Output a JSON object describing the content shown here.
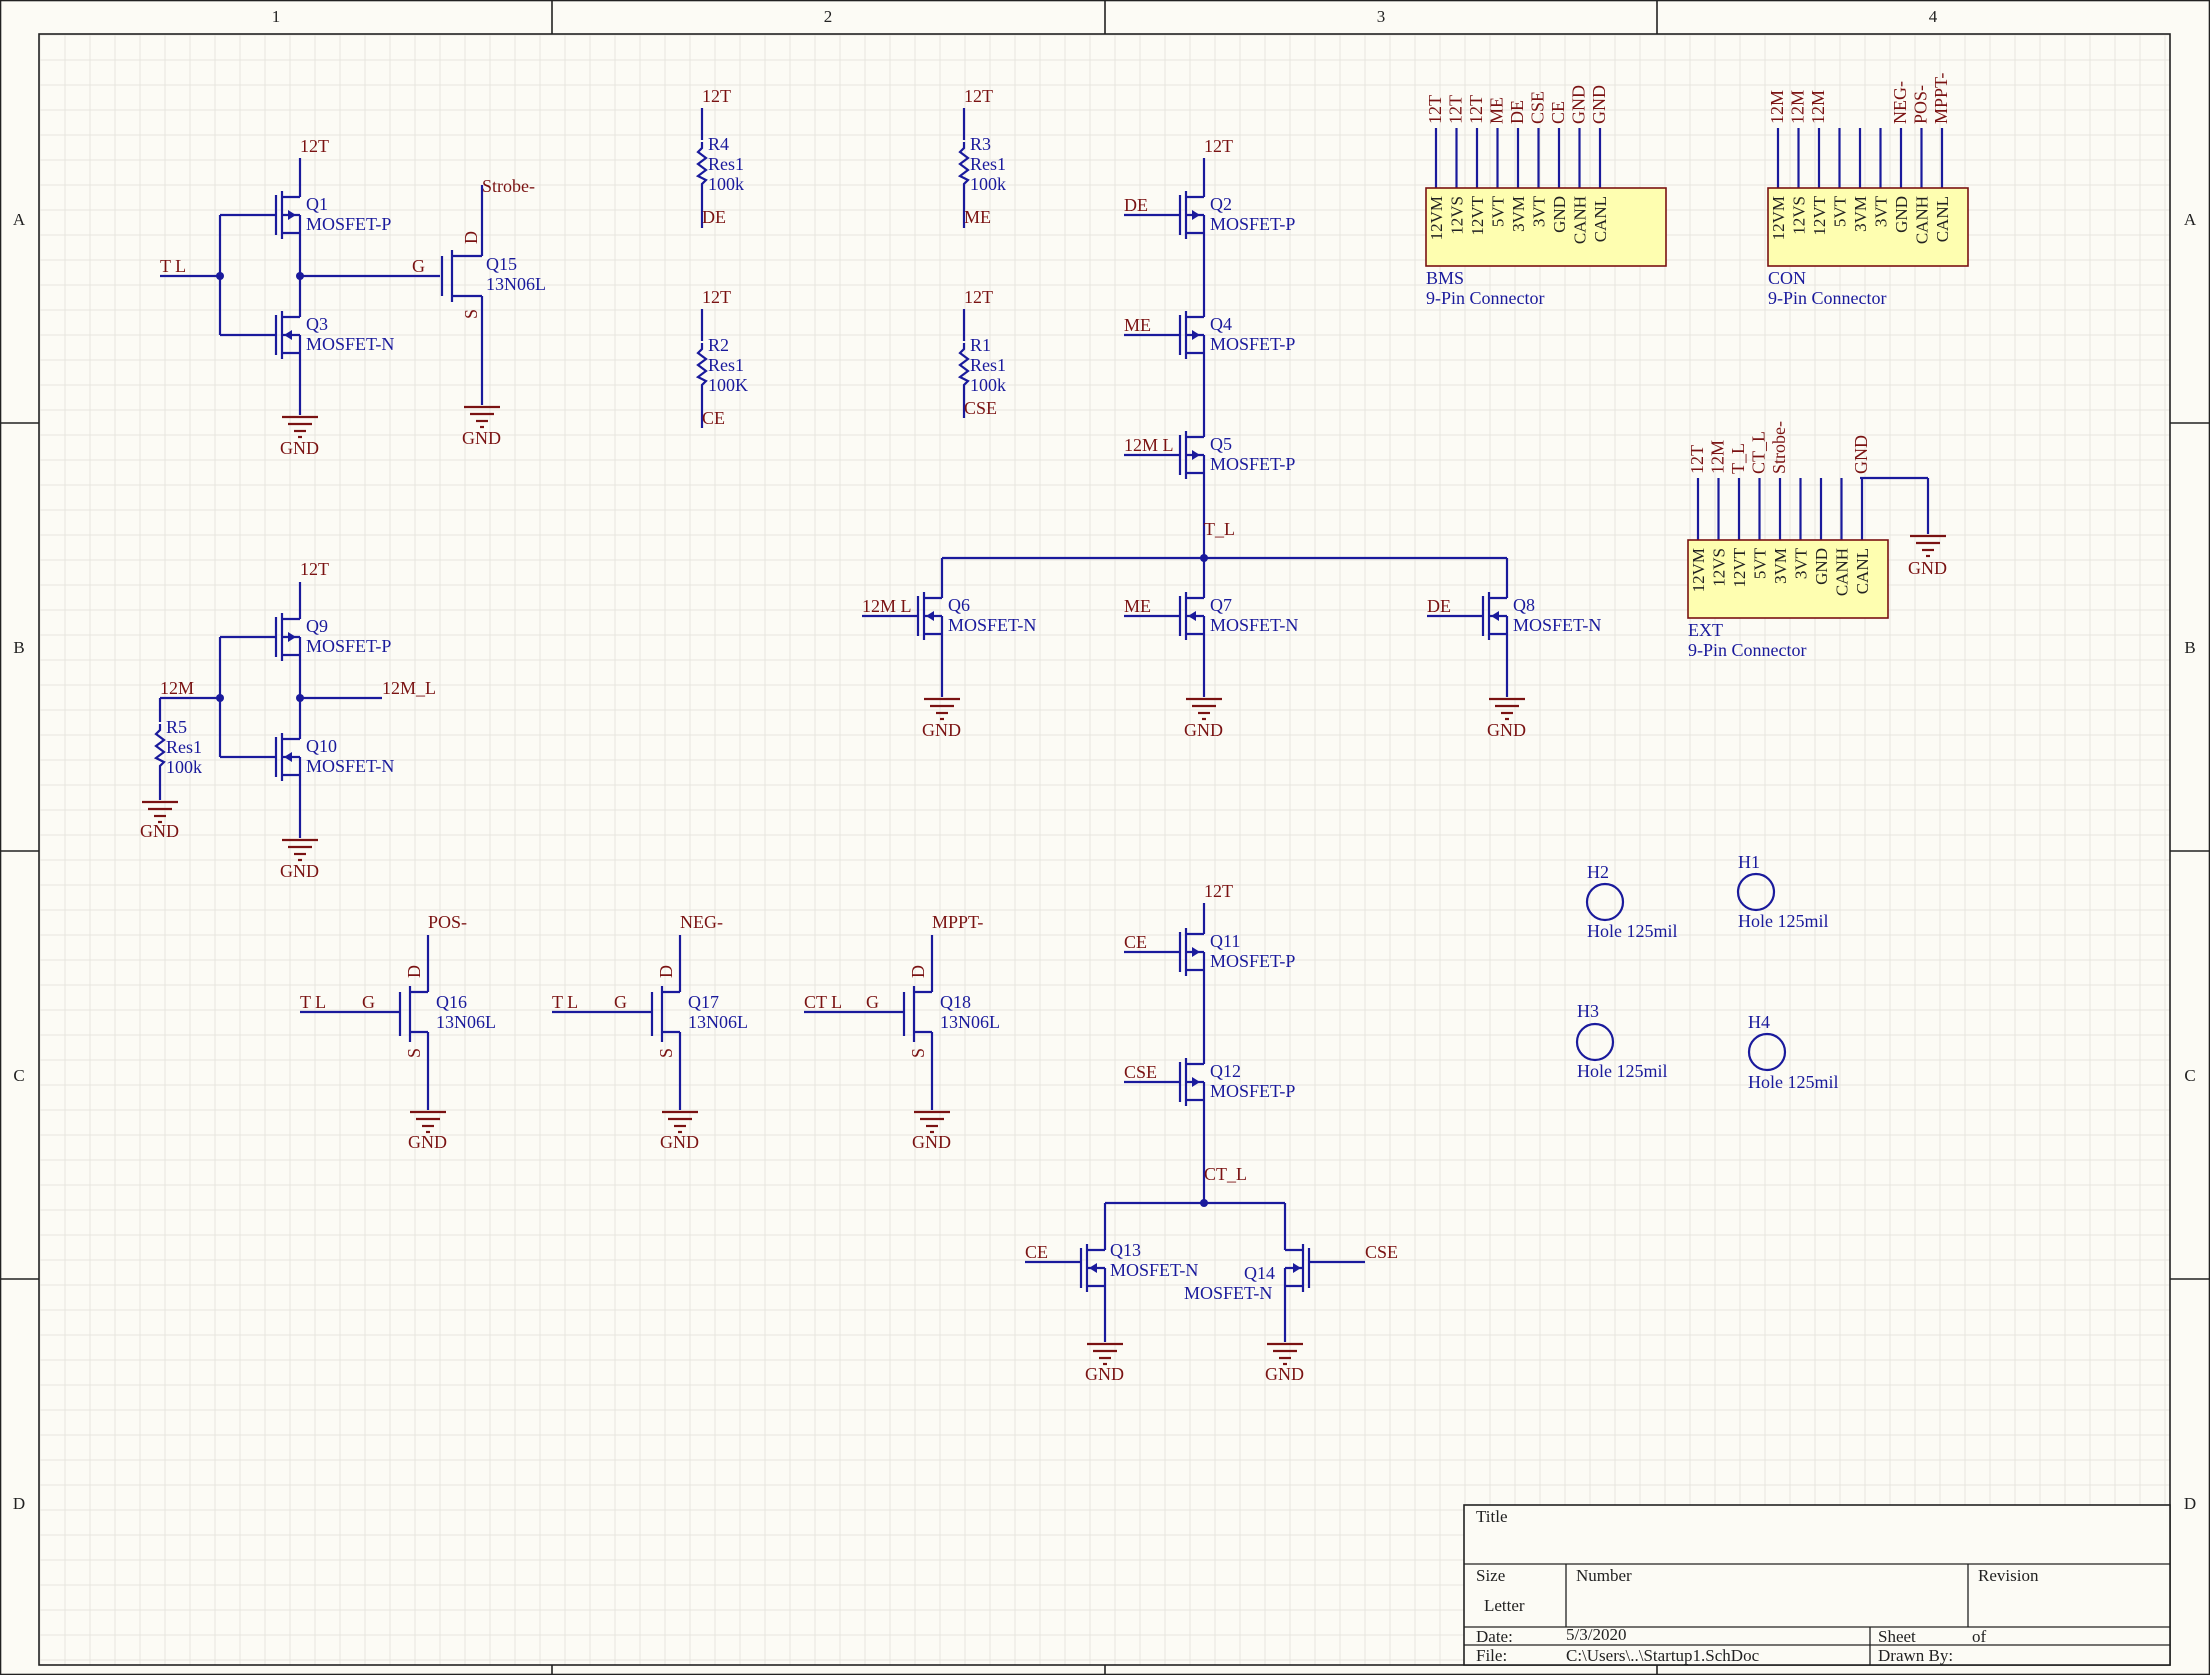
{
  "sheet": {
    "columns": [
      "1",
      "2",
      "3",
      "4"
    ],
    "rows": [
      "A",
      "B",
      "C",
      "D"
    ]
  },
  "components": {
    "Q1": {
      "designator": "Q1",
      "type": "MOSFET-P"
    },
    "Q3": {
      "designator": "Q3",
      "type": "MOSFET-N"
    },
    "Q9": {
      "designator": "Q9",
      "type": "MOSFET-P"
    },
    "Q10": {
      "designator": "Q10",
      "type": "MOSFET-N"
    },
    "Q15": {
      "designator": "Q15",
      "type": "13N06L"
    },
    "Q2": {
      "designator": "Q2",
      "type": "MOSFET-P"
    },
    "Q4": {
      "designator": "Q4",
      "type": "MOSFET-P"
    },
    "Q5": {
      "designator": "Q5",
      "type": "MOSFET-P"
    },
    "Q6": {
      "designator": "Q6",
      "type": "MOSFET-N"
    },
    "Q7": {
      "designator": "Q7",
      "type": "MOSFET-N"
    },
    "Q8": {
      "designator": "Q8",
      "type": "MOSFET-N"
    },
    "Q11": {
      "designator": "Q11",
      "type": "MOSFET-P"
    },
    "Q12": {
      "designator": "Q12",
      "type": "MOSFET-P"
    },
    "Q13": {
      "designator": "Q13",
      "type": "MOSFET-N"
    },
    "Q14": {
      "designator": "Q14",
      "type": "MOSFET-N"
    },
    "Q16": {
      "designator": "Q16",
      "type": "13N06L"
    },
    "Q17": {
      "designator": "Q17",
      "type": "13N06L"
    },
    "Q18": {
      "designator": "Q18",
      "type": "13N06L"
    },
    "R1": {
      "designator": "R1",
      "type": "Res1",
      "value": "100k"
    },
    "R2": {
      "designator": "R2",
      "type": "Res1",
      "value": "100K"
    },
    "R3": {
      "designator": "R3",
      "type": "Res1",
      "value": "100k"
    },
    "R4": {
      "designator": "R4",
      "type": "Res1",
      "value": "100k"
    },
    "R5": {
      "designator": "R5",
      "type": "Res1",
      "value": "100k"
    }
  },
  "nets": {
    "n12T": "12T",
    "gnd": "GND",
    "strobe": "Strobe-",
    "tl": "T_L",
    "tl_sp": "T  L",
    "m12": "12M",
    "m12l": "12M_L",
    "m12l_sp": "12M  L",
    "de": "DE",
    "me": "ME",
    "ce": "CE",
    "cse": "CSE",
    "ctl": "CT_L",
    "ctl_sp": "CT  L",
    "pos": "POS-",
    "neg": "NEG-",
    "mppt": "MPPT-",
    "g": "G",
    "d": "D",
    "s": "S"
  },
  "connectors": {
    "bms": {
      "name": "BMS",
      "type": "9-Pin Connector",
      "nets": [
        "12T",
        "12T",
        "12T",
        "ME",
        "DE",
        "CSE",
        "CE",
        "GND",
        "GND"
      ],
      "pins": [
        "12VM",
        "12VS",
        "12VT",
        "5VT",
        "3VM",
        "3VT",
        "GND",
        "CANH",
        "CANL"
      ]
    },
    "con": {
      "name": "CON",
      "type": "9-Pin Connector",
      "nets": [
        "12M",
        "12M",
        "12M",
        "",
        "",
        "",
        "NEG-",
        "POS-",
        "MPPT-"
      ],
      "pins": [
        "12VM",
        "12VS",
        "12VT",
        "5VT",
        "3VM",
        "3VT",
        "GND",
        "CANH",
        "CANL"
      ]
    },
    "ext": {
      "name": "EXT",
      "type": "9-Pin Connector",
      "nets": [
        "12T",
        "12M",
        "T_L",
        "CT_L",
        "Strobe-",
        "",
        "",
        "",
        "GND"
      ],
      "pins": [
        "12VM",
        "12VS",
        "12VT",
        "5VT",
        "3VM",
        "3VT",
        "GND",
        "CANH",
        "CANL"
      ],
      "gnd": "GND"
    }
  },
  "holes": [
    {
      "name": "H1",
      "label": "Hole 125mil"
    },
    {
      "name": "H2",
      "label": "Hole 125mil"
    },
    {
      "name": "H3",
      "label": "Hole 125mil"
    },
    {
      "name": "H4",
      "label": "Hole 125mil"
    }
  ],
  "title_block": {
    "title_label": "Title",
    "size_label": "Size",
    "size_value": "Letter",
    "number_label": "Number",
    "revision_label": "Revision",
    "date_label": "Date:",
    "date_value": "5/3/2020",
    "sheet_label": "Sheet",
    "of_label": "of",
    "file_label": "File:",
    "file_value": "C:\\Users\\..\\Startup1.SchDoc",
    "drawn_by_label": "Drawn By:"
  }
}
